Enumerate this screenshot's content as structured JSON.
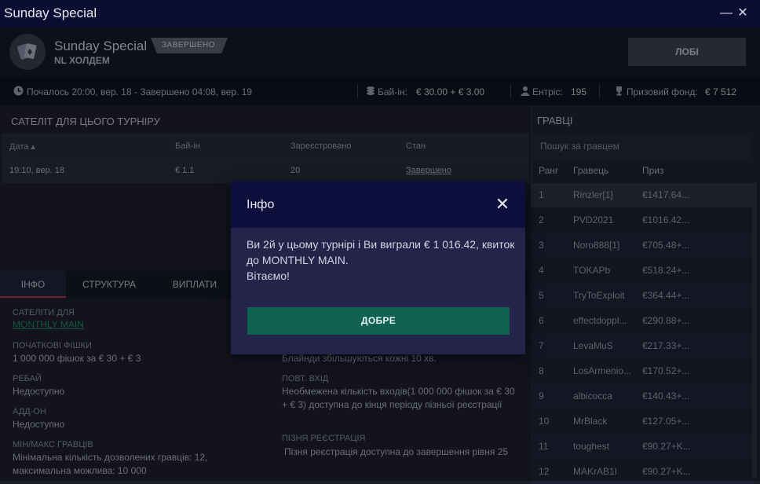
{
  "window": {
    "title": "Sunday Special"
  },
  "header": {
    "title": "Sunday Special",
    "game": "NL ХОЛДЕМ",
    "status_badge": "ЗАВЕРШЕНО",
    "lobby_button": "ЛОБІ"
  },
  "strip": {
    "schedule": "Почалось 20:00, вер. 18  -  Завершено 04:08, вер. 19",
    "buyin_label": "Бай-ін:",
    "buyin_value": "€ 30.00 + € 3.00",
    "entries_label": "Ентріс:",
    "entries_value": "195",
    "prize_label": "Призовий фонд:",
    "prize_value": "€ 7 512"
  },
  "satellites": {
    "title": "САТЕЛІТ ДЛЯ ЦЬОГО ТУРНІРУ",
    "columns": [
      "Дата",
      "Бай-ін",
      "Зареєстровано",
      "Стан"
    ],
    "rows": [
      {
        "date": "19:10, вер. 18",
        "buyin": "€ 1.1",
        "registered": "20",
        "status": "Завершено"
      }
    ]
  },
  "tabs": [
    "ІНФО",
    "СТРУКТУРА",
    "ВИПЛАТИ"
  ],
  "info": {
    "satellites_for_label": "САТЕЛІТИ ДЛЯ",
    "satellites_for_value": "MONTHLY MAIN",
    "starting_chips_label": "ПОЧАТКОВІ ФІШКИ",
    "starting_chips_value": "1 000 000 фішок за € 30 + € 3",
    "rebuy_label": "РЕБАЙ",
    "rebuy_value": "Недоступно",
    "addon_label": "АДД-ОН",
    "addon_value": "Недоступно",
    "players_label": "МІН/МАКС ГРАВЦІВ",
    "players_value": "Мінімальна кількість дозволених гравців: 12, максимальна можлива: 10 000",
    "blinds_value": "Блайнди збільшуються кожні 10 хв.",
    "reentry_label": "ПОВТ. ВХІД",
    "reentry_value": "Необмежена кількість входів(1 000 000 фішок за € 30 + € 3) доступна до кінця періоду пізньої реєстрації",
    "late_reg_label": "ПІЗНЯ РЕЄСТРАЦІЯ",
    "late_reg_value": "Пізня реєстрація доступна до завершення рівня 25"
  },
  "players": {
    "title": "ГРАВЦІ",
    "search_placeholder": "Пошук за гравцем",
    "columns": [
      "Ранг",
      "Гравець",
      "Приз"
    ],
    "rows": [
      {
        "rank": "1",
        "name": "Rinzler[1]",
        "prize": "€1417.64..."
      },
      {
        "rank": "2",
        "name": "PVD2021",
        "prize": "€1016.42..."
      },
      {
        "rank": "3",
        "name": "Noro888[1]",
        "prize": "€705.48+..."
      },
      {
        "rank": "4",
        "name": "TOKAPb",
        "prize": "€518.24+..."
      },
      {
        "rank": "5",
        "name": "TryToExploit",
        "prize": "€364.44+..."
      },
      {
        "rank": "6",
        "name": "effectdoppl...",
        "prize": "€290.88+..."
      },
      {
        "rank": "7",
        "name": "LevaMuS",
        "prize": "€217.33+..."
      },
      {
        "rank": "8",
        "name": "LosArmenio...",
        "prize": "€170.52+..."
      },
      {
        "rank": "9",
        "name": "albicocca",
        "prize": "€140.43+..."
      },
      {
        "rank": "10",
        "name": "MrBlack",
        "prize": "€127.05+..."
      },
      {
        "rank": "11",
        "name": "toughest",
        "prize": "€90.27+K..."
      },
      {
        "rank": "12",
        "name": "MAKrAB1I",
        "prize": "€90.27+K..."
      }
    ]
  },
  "modal": {
    "title": "Інфо",
    "message": "Ви 2й у цьому турнірі і Ви виграли € 1 016.42, квиток до MONTHLY MAIN.",
    "congrats": "Вітаємо!",
    "ok_button": "ДОБРЕ"
  },
  "colors": {
    "accent": "#106353",
    "link": "#1f8a63",
    "tab_active": "#b43a4a",
    "titlebar": "#0b0e32"
  }
}
